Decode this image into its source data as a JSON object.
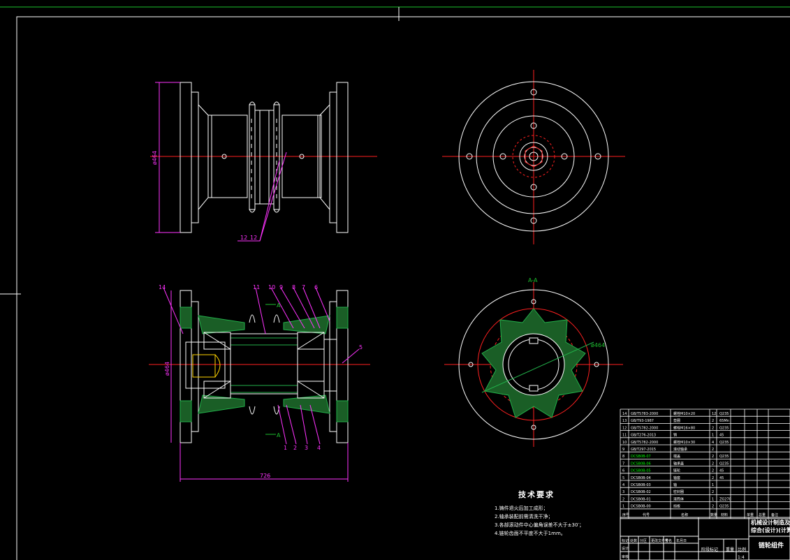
{
  "drawing": {
    "dimensions": {
      "height_top": "ø464",
      "height_bottom": "ø464",
      "length": "726",
      "circle": "ø464"
    },
    "balloons_top": [
      "12",
      "12"
    ],
    "balloons_bottom_top": [
      "14",
      "11",
      "10",
      "9",
      "8",
      "7",
      "6"
    ],
    "balloons_bottom_bot": [
      "1",
      "2",
      "3",
      "4"
    ],
    "balloon_right": "5",
    "section_label_top": "A-A",
    "section_arrow_a": "A"
  },
  "technical_requirements": {
    "title": "技术要求",
    "items": [
      "1.铸件退火后加工成形；",
      "2.轴承装配前需清洗干净；",
      "3.各部滚动件中心偏角误差不大于±30′；",
      "4.链轮齿面不平度不大于1mm。"
    ]
  },
  "parts_list": {
    "rows": [
      [
        "14",
        "GB/T5783-2000",
        "螺栓M10×20",
        "12",
        "Q235"
      ],
      [
        "13",
        "GB/T93-1987",
        "垫圈",
        "2",
        "65Mn"
      ],
      [
        "12",
        "GB/T5782-2000",
        "螺栓M16×80",
        "2",
        "Q235"
      ],
      [
        "11",
        "GB/T276-2013",
        "销",
        "1",
        "45"
      ],
      [
        "10",
        "GB/T5782-2000",
        "螺栓M10×30",
        "4",
        "Q235"
      ],
      [
        "9",
        "GB/T297-2015",
        "滚动轴承",
        "2",
        ""
      ],
      [
        "8",
        "DCSB0B-07",
        "端盖",
        "2",
        "Q235"
      ],
      [
        "7",
        "DCSB0B-06",
        "轴承盖",
        "2",
        "Q235"
      ],
      [
        "6",
        "DCSB0B-05",
        "链轮",
        "2",
        "45"
      ],
      [
        "5",
        "DCSB0B-04",
        "轴套",
        "2",
        "45"
      ],
      [
        "4",
        "DCSB0B-03",
        "轴",
        "1",
        ""
      ],
      [
        "3",
        "DCSB0B-02",
        "密封圈",
        "2",
        ""
      ],
      [
        "2",
        "DCSB0B-01",
        "滚筒体",
        "1",
        "ZG270"
      ],
      [
        "1",
        "DCSB0B-00",
        "挡板",
        "2",
        "Q235"
      ]
    ],
    "header": [
      "序号",
      "代号",
      "名称",
      "数量",
      "材料",
      "单重",
      "总重",
      "备注"
    ]
  },
  "title_block": {
    "school": "机械设计制造及其",
    "drawing_name": "链轮组件",
    "project": "综合(设计)(计算)",
    "scale_label": "比例",
    "scale": "1:4",
    "weight_label": "重量",
    "stage_label": "阶段标记",
    "roles": [
      "设计",
      "审核",
      "工艺",
      "批准"
    ],
    "columns": [
      "标记",
      "处数",
      "分区",
      "更改文件号",
      "签名",
      "年月日"
    ]
  },
  "colors": {
    "line": "#ffffff",
    "center": "#ff2020",
    "dim": "#ff33ff",
    "hatch": "#22b04a",
    "green_text": "#00ff00",
    "frame": "#ffffff",
    "top_line": "#1dbf2e"
  }
}
